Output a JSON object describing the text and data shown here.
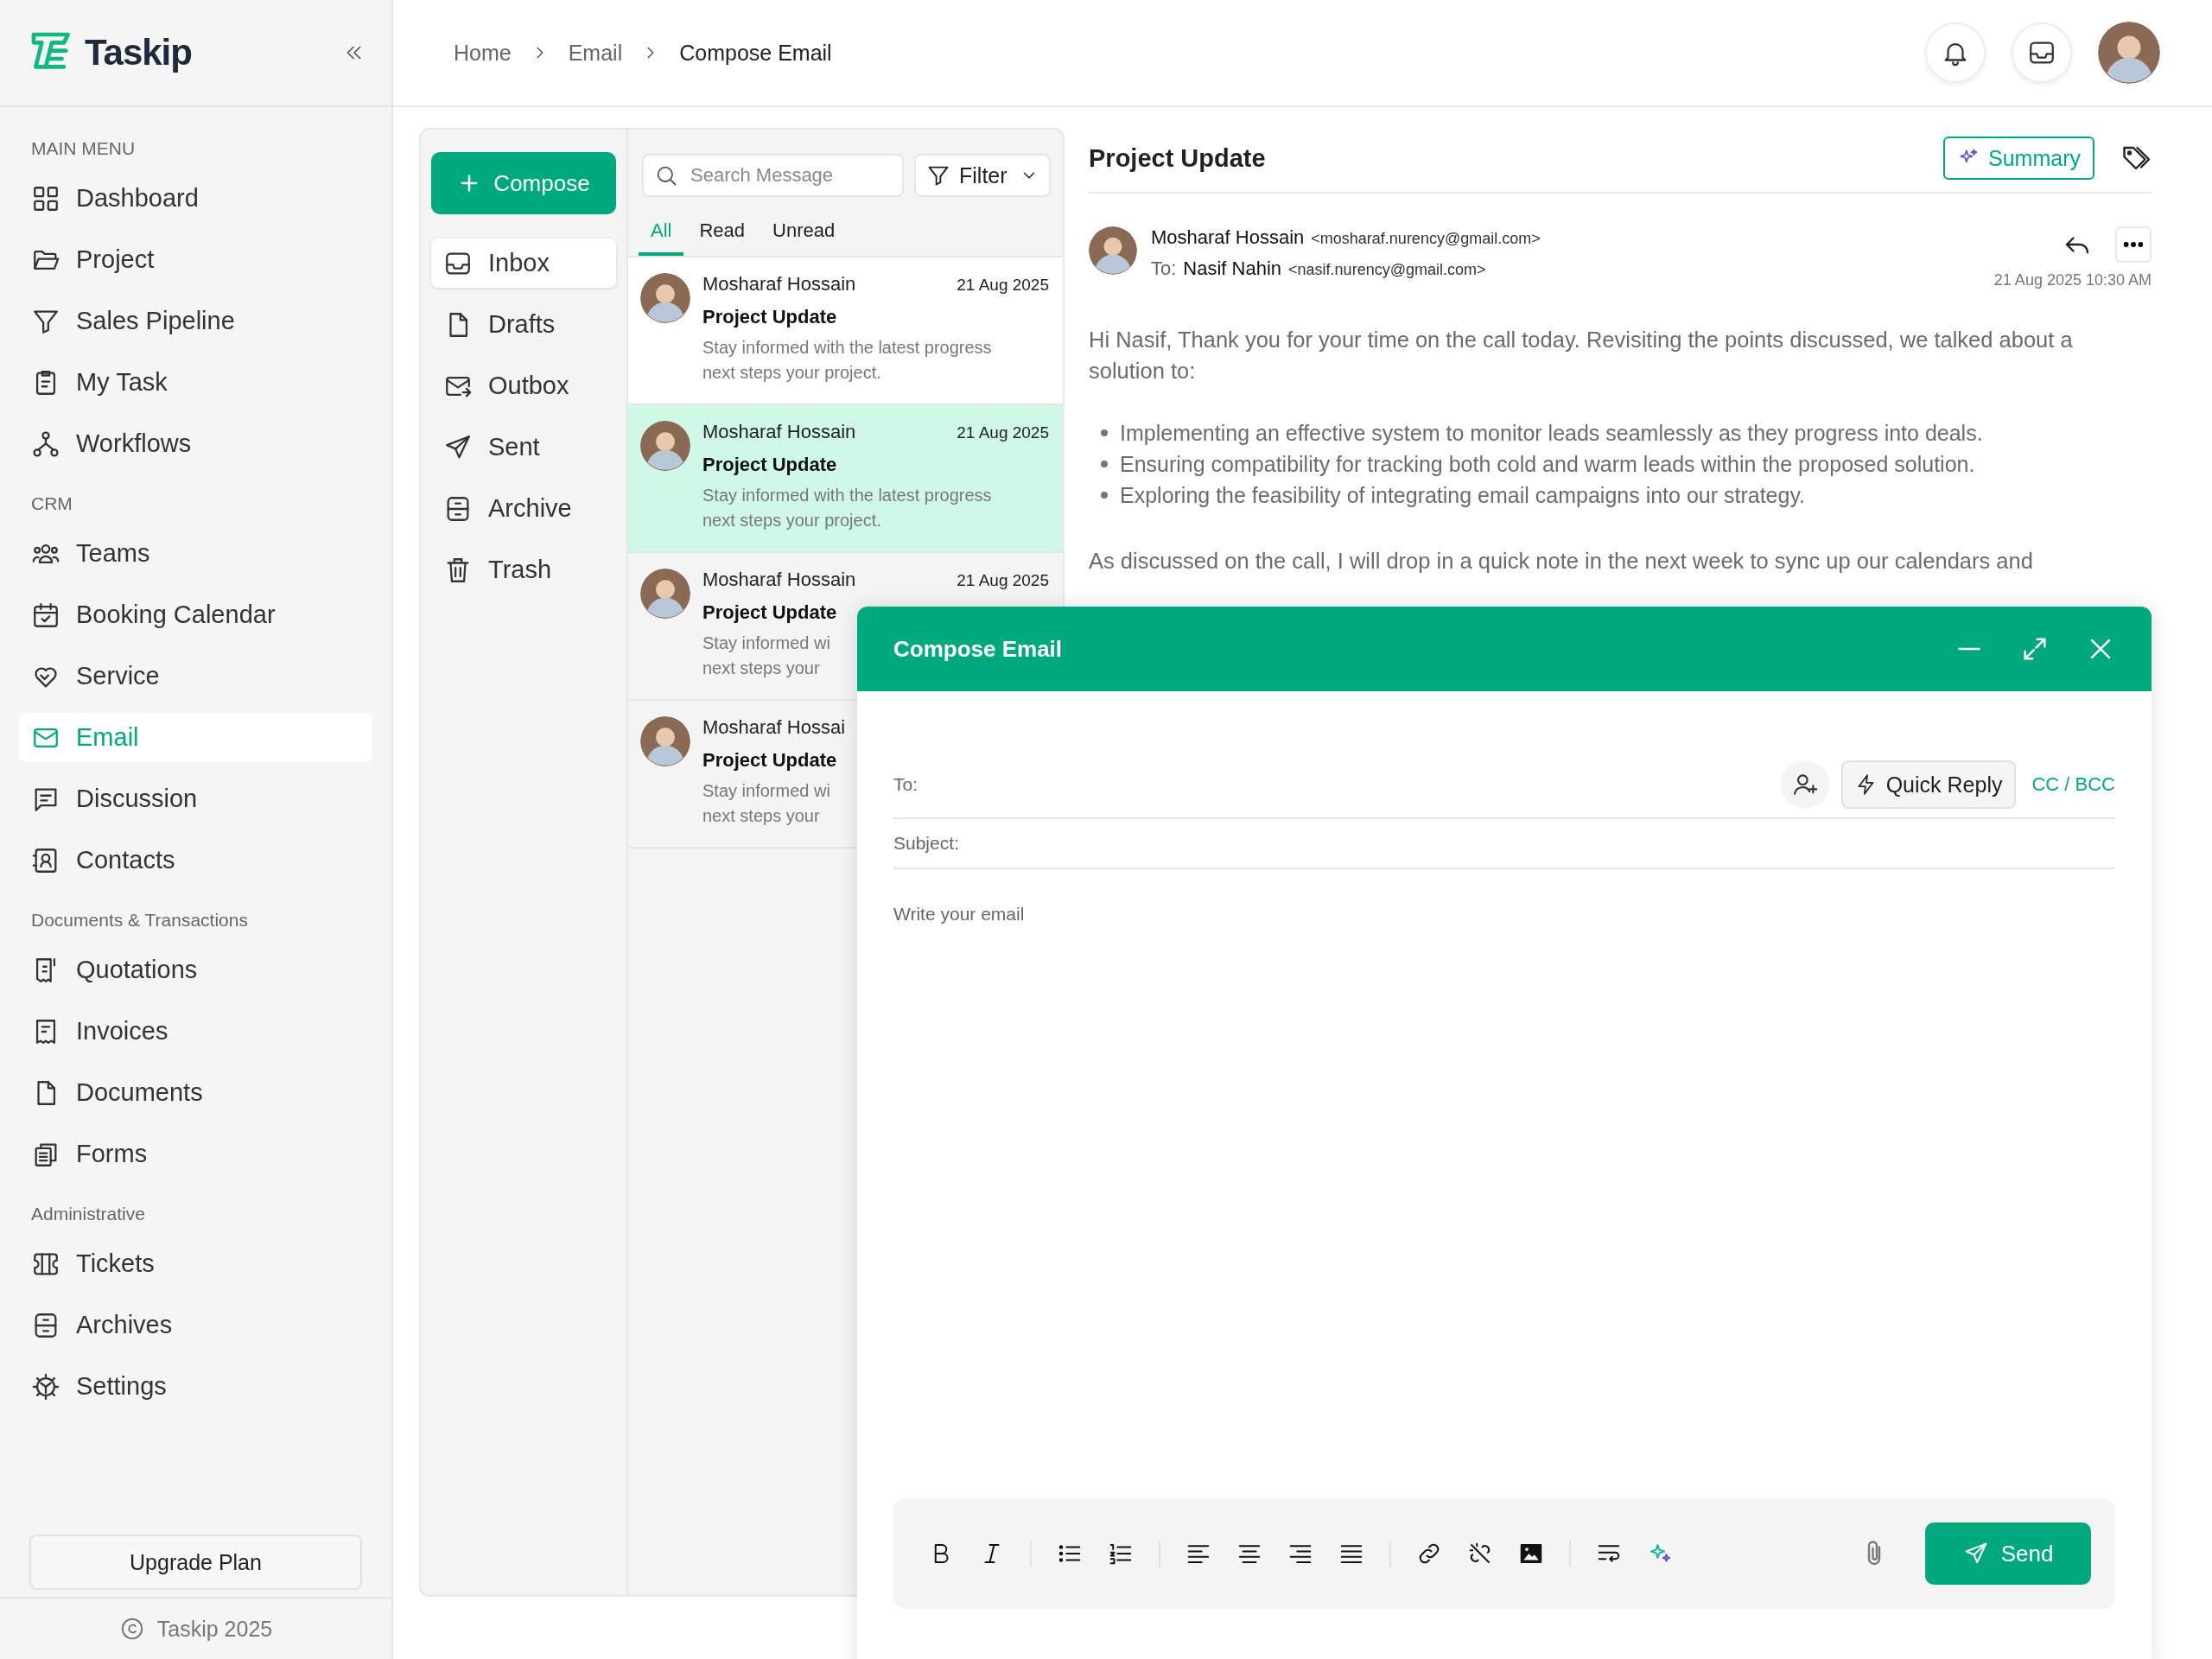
{
  "brand": {
    "name": "Taskip"
  },
  "sidebar": {
    "sections": [
      {
        "title": "MAIN MENU",
        "items": [
          {
            "label": "Dashboard",
            "selected": false
          },
          {
            "label": "Project",
            "selected": false
          },
          {
            "label": "Sales Pipeline",
            "selected": false
          },
          {
            "label": "My Task",
            "selected": false
          },
          {
            "label": "Workflows",
            "selected": false
          }
        ]
      },
      {
        "title": "CRM",
        "items": [
          {
            "label": "Teams",
            "selected": false
          },
          {
            "label": "Booking Calendar",
            "selected": false
          },
          {
            "label": "Service",
            "selected": false
          },
          {
            "label": "Email",
            "selected": true
          },
          {
            "label": "Discussion",
            "selected": false
          },
          {
            "label": "Contacts",
            "selected": false
          }
        ]
      },
      {
        "title": "Documents & Transactions",
        "items": [
          {
            "label": "Quotations",
            "selected": false
          },
          {
            "label": "Invoices",
            "selected": false
          },
          {
            "label": "Documents",
            "selected": false
          },
          {
            "label": "Forms",
            "selected": false
          }
        ]
      },
      {
        "title": "Administrative",
        "items": [
          {
            "label": "Tickets",
            "selected": false
          },
          {
            "label": "Archives",
            "selected": false
          },
          {
            "label": "Settings",
            "selected": false
          }
        ]
      }
    ],
    "upgrade_button": "Upgrade Plan",
    "footer": "Taskip 2025"
  },
  "breadcrumb": [
    "Home",
    "Email",
    "Compose Email"
  ],
  "mail": {
    "compose_button": "Compose",
    "folders": [
      {
        "label": "Inbox",
        "selected": true
      },
      {
        "label": "Drafts",
        "selected": false
      },
      {
        "label": "Outbox",
        "selected": false
      },
      {
        "label": "Sent",
        "selected": false
      },
      {
        "label": "Archive",
        "selected": false
      },
      {
        "label": "Trash",
        "selected": false
      }
    ],
    "search": {
      "placeholder": "Search Message"
    },
    "filter_button": "Filter",
    "tabs": [
      {
        "label": "All",
        "selected": true
      },
      {
        "label": "Read",
        "selected": false
      },
      {
        "label": "Unread",
        "selected": false
      }
    ],
    "messages": [
      {
        "sender": "Mosharaf Hossain",
        "date": "21 Aug 2025",
        "subject": "Project Update",
        "preview": [
          "Stay informed with the latest progress",
          "next steps your project."
        ],
        "selected": false
      },
      {
        "sender": "Mosharaf Hossain",
        "date": "21 Aug 2025",
        "subject": "Project Update",
        "preview": [
          "Stay informed with the latest progress",
          "next steps your project."
        ],
        "selected": true
      },
      {
        "sender": "Mosharaf Hossain",
        "date": "21 Aug 2025",
        "subject": "Project Update",
        "preview": [
          "Stay informed wi",
          "next steps your"
        ],
        "selected": false
      },
      {
        "sender": "Mosharaf Hossai",
        "subject": "Project Update",
        "preview": [
          "Stay informed wi",
          "next steps your"
        ],
        "selected": false
      }
    ]
  },
  "reader": {
    "title": "Project Update",
    "summary_button": "Summary",
    "sender": "Mosharaf Hossain",
    "sender_email": "<mosharaf.nurency@gmail.com>",
    "to_label": "To:",
    "recipient": "Nasif Nahin",
    "recipient_email": "<nasif.nurency@gmail.com>",
    "date": "21 Aug 2025 10:30 AM",
    "intro": "Hi Nasif, Thank you for your time on the call today. Revisiting the points discussed, we talked about a solution to:",
    "bullets": [
      "Implementing an effective system to monitor leads seamlessly as they progress into deals.",
      "Ensuring compatibility for tracking both cold and warm leads within the proposed solution.",
      "Exploring the feasibility of integrating email campaigns into our strategy."
    ],
    "closing": "As discussed on the call, I will drop in a quick note in the next week to sync up our calendars and"
  },
  "compose": {
    "title": "Compose Email",
    "to_label": "To:",
    "quick_reply": "Quick Reply",
    "cc_bcc": "CC / BCC",
    "subject_label": "Subject:",
    "body": {
      "placeholder": "Write your email"
    },
    "send_button": "Send"
  }
}
